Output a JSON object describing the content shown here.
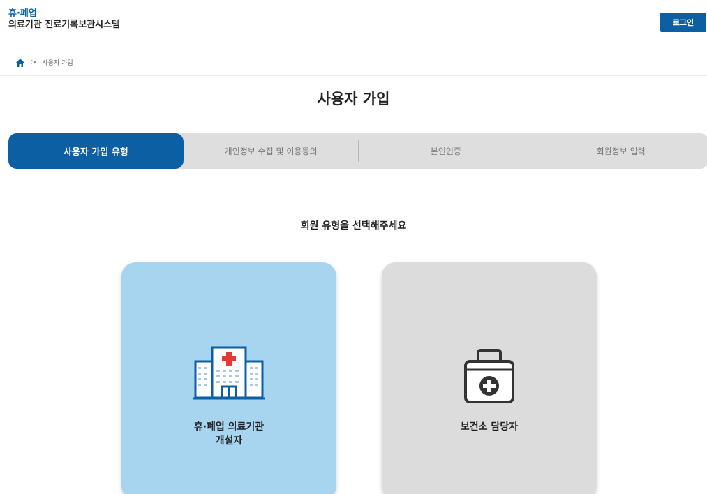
{
  "header": {
    "brand_line1": "휴·폐업",
    "brand_line2": "의료기관 진료기록보관시스템",
    "login_label": "로그인"
  },
  "breadcrumb": {
    "home_icon": "home-icon",
    "separator": ">",
    "current": "사용자 가입"
  },
  "page": {
    "title": "사용자 가입"
  },
  "steps": [
    {
      "label": "사용자 가입 유형",
      "active": true
    },
    {
      "label": "개인정보 수집 및 이용동의",
      "active": false
    },
    {
      "label": "본인인증",
      "active": false
    },
    {
      "label": "회원정보 입력",
      "active": false
    }
  ],
  "member_type": {
    "prompt": "회원 유형을 선택해주세요",
    "options": [
      {
        "label": "휴·폐업 의료기관\n개설자",
        "icon": "hospital-icon"
      },
      {
        "label": "보건소 담당자",
        "icon": "first-aid-kit-icon"
      }
    ]
  },
  "colors": {
    "primary": "#0d5fa3",
    "card_selected": "#a7d5f0",
    "card_default": "#dcdcdc",
    "steps_bg": "#dedede"
  }
}
